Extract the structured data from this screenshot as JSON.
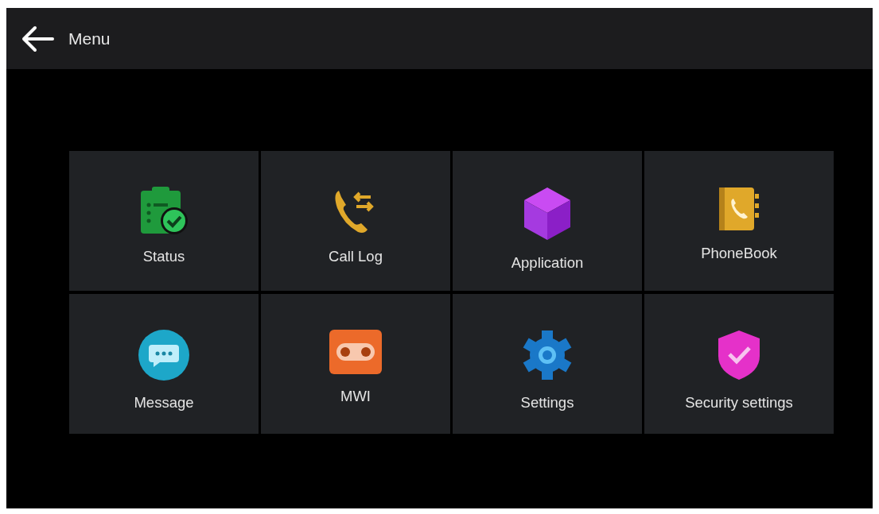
{
  "header": {
    "title": "Menu"
  },
  "tiles": [
    {
      "label": "Status",
      "kind": "status"
    },
    {
      "label": "Call Log",
      "kind": "calllog"
    },
    {
      "label": "Application",
      "kind": "application"
    },
    {
      "label": "PhoneBook",
      "kind": "phonebook"
    },
    {
      "label": "Message",
      "kind": "message"
    },
    {
      "label": "MWI",
      "kind": "mwi"
    },
    {
      "label": "Settings",
      "kind": "settings"
    },
    {
      "label": "Security settings",
      "kind": "security"
    }
  ]
}
